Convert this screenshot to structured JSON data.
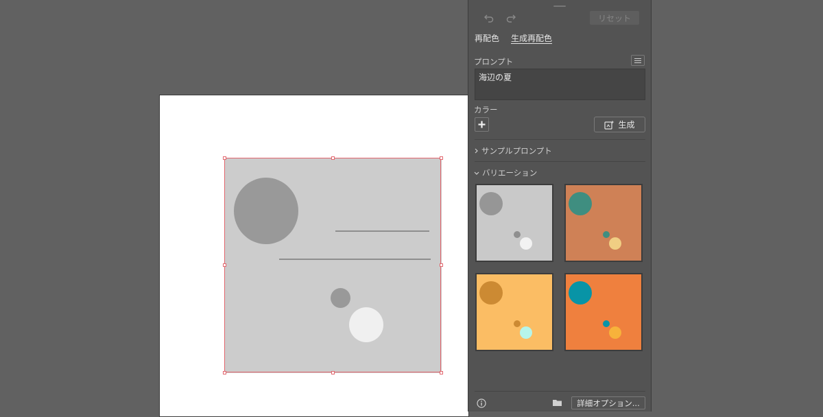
{
  "panel": {
    "reset_label": "リセット",
    "tabs": [
      {
        "label": "再配色",
        "active": false
      },
      {
        "label": "生成再配色",
        "active": true
      }
    ],
    "prompt_label": "プロンプト",
    "prompt_value": "海辺の夏",
    "color_label": "カラー",
    "generate_label": "生成",
    "sample_prompts_label": "サンプルプロンプト",
    "variations_label": "バリエーション",
    "detail_options_label": "詳細オプション..."
  },
  "icons": {
    "undo": "undo-icon",
    "redo": "redo-icon",
    "menu": "menu-icon",
    "add": "plus-icon",
    "generate": "generate-icon",
    "info": "info-icon",
    "folder": "folder-icon"
  },
  "colors": {
    "canvas_bg": "#616161",
    "panel_bg": "#535353",
    "selection": "#e2656d",
    "artwork_bg": "#cccccc"
  },
  "variations": [
    {
      "bg": "#c9c9c9",
      "big": "#969696",
      "small": "#8f8f8f",
      "light": "#f2f2f2"
    },
    {
      "bg": "#cf8156",
      "big": "#3f8e80",
      "small": "#3f8e80",
      "light": "#f0ce83"
    },
    {
      "bg": "#fbbd64",
      "big": "#cc8a33",
      "small": "#cc8a33",
      "light": "#b6f5ea"
    },
    {
      "bg": "#ef803e",
      "big": "#0894a6",
      "small": "#0894a6",
      "light": "#f7b23b"
    }
  ]
}
